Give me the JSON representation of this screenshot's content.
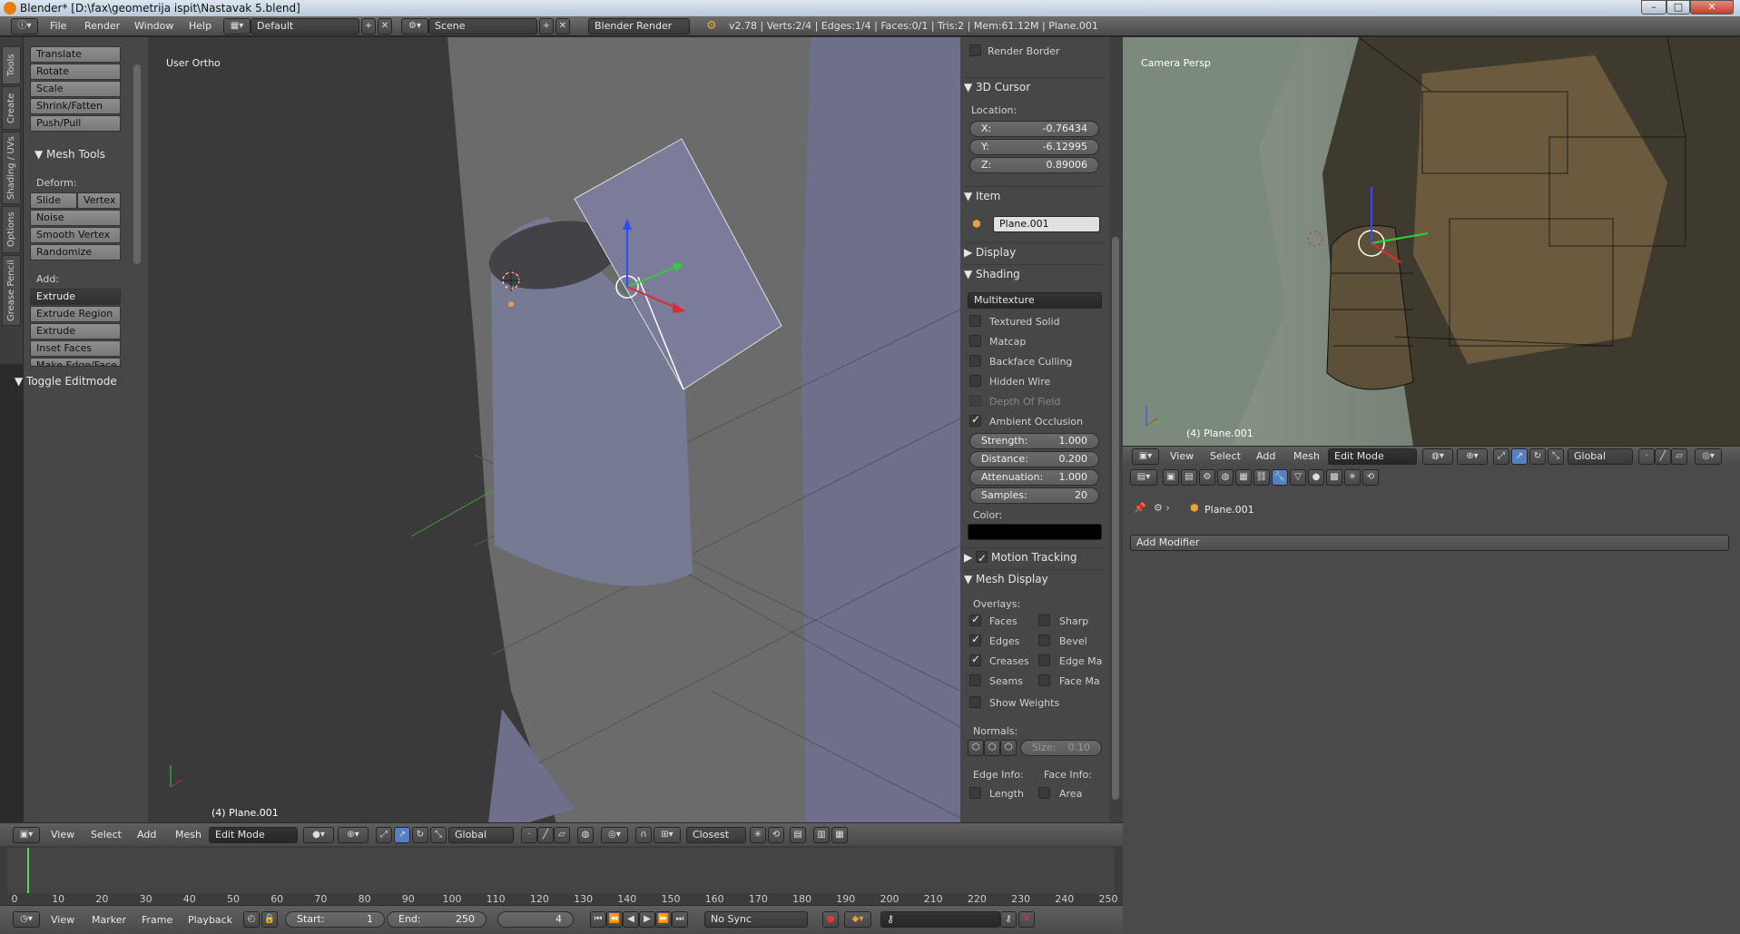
{
  "window": {
    "title": "Blender* [D:\\fax\\geometrija ispit\\Nastavak 5.blend]"
  },
  "topbar": {
    "menus": [
      "File",
      "Render",
      "Window",
      "Help"
    ],
    "layout": "Default",
    "scene": "Scene",
    "engine": "Blender Render",
    "stats": "v2.78 | Verts:2/4 | Edges:1/4 | Faces:0/1 | Tris:2 | Mem:61.12M | Plane.001"
  },
  "lefttabs": [
    "Tools",
    "Create",
    "Shading / UVs",
    "Options",
    "Grease Pencil"
  ],
  "tools": {
    "transform": [
      "Translate",
      "Rotate",
      "Scale",
      "Shrink/Fatten",
      "Push/Pull"
    ],
    "mesh_tools_title": "Mesh Tools",
    "deform_label": "Deform:",
    "slide": "Slide Ed",
    "vertex": "Vertex",
    "deform": [
      "Noise",
      "Smooth Vertex",
      "Randomize"
    ],
    "add_label": "Add:",
    "add": [
      "Extrude",
      "Extrude Region",
      "Extrude Individual",
      "Inset Faces",
      "Make Edge/Face"
    ],
    "toggle": "Toggle Editmode"
  },
  "viewport": {
    "label": "User Ortho",
    "object": "(4) Plane.001"
  },
  "npanel": {
    "render_border": "Render Border",
    "cursor_title": "3D Cursor",
    "location": "Location:",
    "x_label": "X:",
    "x": "-0.76434",
    "y_label": "Y:",
    "y": "-6.12995",
    "z_label": "Z:",
    "z": "0.89006",
    "item_title": "Item",
    "item_name": "Plane.001",
    "display_title": "Display",
    "shading_title": "Shading",
    "shading_mode": "Multitexture",
    "shading_opts": [
      "Textured Solid",
      "Matcap",
      "Backface Culling",
      "Hidden Wire",
      "Depth Of Field",
      "Ambient Occlusion"
    ],
    "strength_l": "Strength:",
    "strength": "1.000",
    "distance_l": "Distance:",
    "distance": "0.200",
    "atten_l": "Attenuation:",
    "atten": "1.000",
    "samples_l": "Samples:",
    "samples": "20",
    "color_l": "Color:",
    "motion": "Motion Tracking",
    "mesh_display": "Mesh Display",
    "overlays": "Overlays:",
    "faces": "Faces",
    "edges": "Edges",
    "creases": "Creases",
    "seams": "Seams",
    "sharp": "Sharp",
    "bevel": "Bevel",
    "edgema": "Edge Ma",
    "facema": "Face Ma",
    "weights": "Show Weights",
    "normals": "Normals:",
    "size": "Size:",
    "size_v": "0.10",
    "edgeinfo": "Edge Info:",
    "faceinfo": "Face Info:",
    "length": "Length",
    "area": "Area"
  },
  "viewhdr": {
    "menus": [
      "View",
      "Select",
      "Add",
      "Mesh"
    ],
    "mode": "Edit Mode",
    "orient": "Global",
    "snap": "Closest"
  },
  "timeline": {
    "ticks": [
      "0",
      "10",
      "20",
      "30",
      "40",
      "50",
      "60",
      "70",
      "80",
      "90",
      "100",
      "110",
      "120",
      "130",
      "140",
      "150",
      "160",
      "170",
      "180",
      "190",
      "200",
      "210",
      "220",
      "230",
      "240",
      "250"
    ],
    "menus": [
      "View",
      "Marker",
      "Frame",
      "Playback"
    ],
    "start_l": "Start:",
    "start": "1",
    "end_l": "End:",
    "end": "250",
    "frame": "4",
    "sync": "No Sync"
  },
  "camview": {
    "label": "Camera Persp",
    "object": "(4) Plane.001",
    "menus": [
      "View",
      "Select",
      "Add",
      "Mesh"
    ],
    "mode": "Edit Mode",
    "orient": "Global"
  },
  "props": {
    "object": "Plane.001",
    "modifier": "Add Modifier"
  }
}
